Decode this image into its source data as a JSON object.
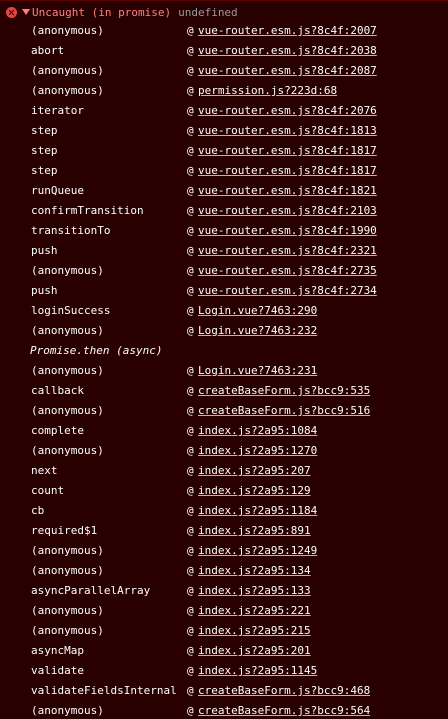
{
  "header": {
    "title": "Uncaught (in promise)",
    "value": "undefined",
    "icon": "error-circle-icon",
    "disclosure_icon": "expand-triangle-icon",
    "colors": {
      "error_text": "#ff8080",
      "background": "#290000",
      "muted": "#9a9a9a"
    }
  },
  "at_sign": "@",
  "frames": [
    {
      "fn": "(anonymous)",
      "loc": "vue-router.esm.js?8c4f:2007"
    },
    {
      "fn": "abort",
      "loc": "vue-router.esm.js?8c4f:2038"
    },
    {
      "fn": "(anonymous)",
      "loc": "vue-router.esm.js?8c4f:2087"
    },
    {
      "fn": "(anonymous)",
      "loc": "permission.js?223d:68"
    },
    {
      "fn": "iterator",
      "loc": "vue-router.esm.js?8c4f:2076"
    },
    {
      "fn": "step",
      "loc": "vue-router.esm.js?8c4f:1813"
    },
    {
      "fn": "step",
      "loc": "vue-router.esm.js?8c4f:1817"
    },
    {
      "fn": "step",
      "loc": "vue-router.esm.js?8c4f:1817"
    },
    {
      "fn": "runQueue",
      "loc": "vue-router.esm.js?8c4f:1821"
    },
    {
      "fn": "confirmTransition",
      "loc": "vue-router.esm.js?8c4f:2103"
    },
    {
      "fn": "transitionTo",
      "loc": "vue-router.esm.js?8c4f:1990"
    },
    {
      "fn": "push",
      "loc": "vue-router.esm.js?8c4f:2321"
    },
    {
      "fn": "(anonymous)",
      "loc": "vue-router.esm.js?8c4f:2735"
    },
    {
      "fn": "push",
      "loc": "vue-router.esm.js?8c4f:2734"
    },
    {
      "fn": "loginSuccess",
      "loc": "Login.vue?7463:290"
    },
    {
      "fn": "(anonymous)",
      "loc": "Login.vue?7463:232"
    },
    {
      "fn": "Promise.then (async)",
      "async": true
    },
    {
      "fn": "(anonymous)",
      "loc": "Login.vue?7463:231"
    },
    {
      "fn": "callback",
      "loc": "createBaseForm.js?bcc9:535"
    },
    {
      "fn": "(anonymous)",
      "loc": "createBaseForm.js?bcc9:516"
    },
    {
      "fn": "complete",
      "loc": "index.js?2a95:1084"
    },
    {
      "fn": "(anonymous)",
      "loc": "index.js?2a95:1270"
    },
    {
      "fn": "next",
      "loc": "index.js?2a95:207"
    },
    {
      "fn": "count",
      "loc": "index.js?2a95:129"
    },
    {
      "fn": "cb",
      "loc": "index.js?2a95:1184"
    },
    {
      "fn": "required$1",
      "loc": "index.js?2a95:891"
    },
    {
      "fn": "(anonymous)",
      "loc": "index.js?2a95:1249"
    },
    {
      "fn": "(anonymous)",
      "loc": "index.js?2a95:134"
    },
    {
      "fn": "asyncParallelArray",
      "loc": "index.js?2a95:133"
    },
    {
      "fn": "(anonymous)",
      "loc": "index.js?2a95:221"
    },
    {
      "fn": "(anonymous)",
      "loc": "index.js?2a95:215"
    },
    {
      "fn": "asyncMap",
      "loc": "index.js?2a95:201"
    },
    {
      "fn": "validate",
      "loc": "index.js?2a95:1145"
    },
    {
      "fn": "validateFieldsInternal",
      "loc": "createBaseForm.js?bcc9:468"
    },
    {
      "fn": "(anonymous)",
      "loc": "createBaseForm.js?bcc9:564"
    }
  ]
}
